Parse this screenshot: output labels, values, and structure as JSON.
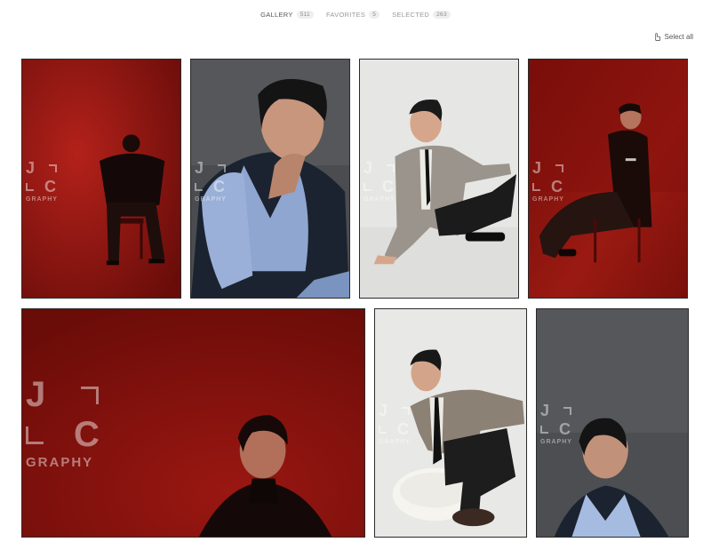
{
  "tabs": [
    {
      "label": "GALLERY",
      "count": "511"
    },
    {
      "label": "FAVORITES",
      "count": "5"
    },
    {
      "label": "SELECTED",
      "count": "263"
    }
  ],
  "select_all": {
    "label": "Select all",
    "icon": "select-all-icon"
  },
  "watermark": {
    "letter_1": "J",
    "letter_2": "C",
    "tag": "GRAPHY"
  },
  "photos": [
    {
      "id": "photo-1",
      "theme": "red"
    },
    {
      "id": "photo-2",
      "theme": "grey"
    },
    {
      "id": "photo-3",
      "theme": "white"
    },
    {
      "id": "photo-4",
      "theme": "red"
    },
    {
      "id": "photo-5",
      "theme": "red"
    },
    {
      "id": "photo-6",
      "theme": "white"
    },
    {
      "id": "photo-7",
      "theme": "grey"
    }
  ],
  "colors": {
    "red_bg": "#8a1410",
    "grey_bg": "#4a4c4f",
    "white_bg": "#e9e9e7",
    "frame": "#2a2a2a"
  }
}
